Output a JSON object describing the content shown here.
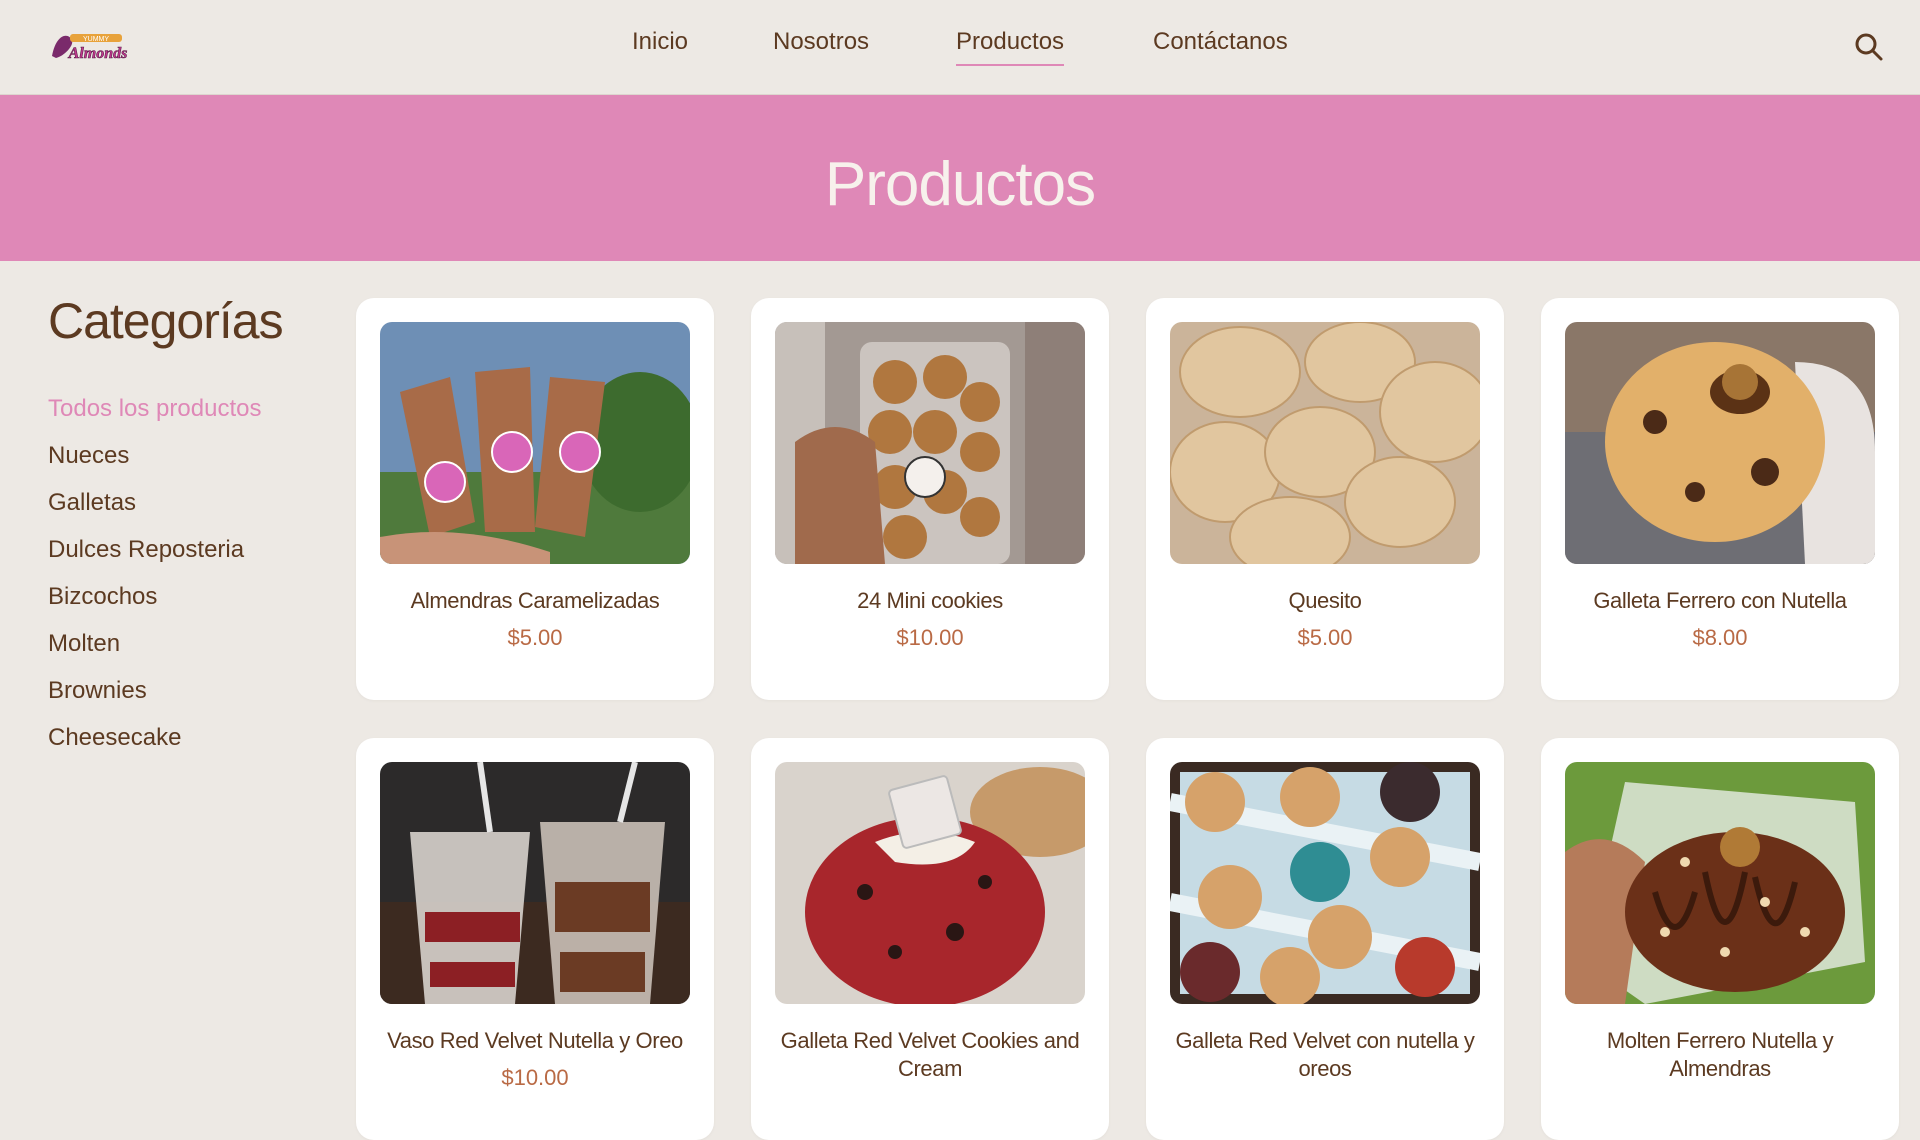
{
  "brand": {
    "logo_text": "Almonds",
    "logo_top_text": "YUMMY"
  },
  "nav": {
    "items": [
      {
        "label": "Inicio",
        "active": false
      },
      {
        "label": "Nosotros",
        "active": false
      },
      {
        "label": "Productos",
        "active": true
      },
      {
        "label": "Contáctanos",
        "active": false
      }
    ],
    "search_icon": "search-icon"
  },
  "banner": {
    "title": "Productos"
  },
  "sidebar": {
    "title": "Categorías",
    "categories": [
      {
        "label": "Todos los productos",
        "active": true
      },
      {
        "label": "Nueces",
        "active": false
      },
      {
        "label": "Galletas",
        "active": false
      },
      {
        "label": "Dulces Reposteria",
        "active": false
      },
      {
        "label": "Bizcochos",
        "active": false
      },
      {
        "label": "Molten",
        "active": false
      },
      {
        "label": "Brownies",
        "active": false
      },
      {
        "label": "Cheesecake",
        "active": false
      }
    ]
  },
  "products": [
    {
      "name": "Almendras Caramelizadas",
      "price": "$5.00"
    },
    {
      "name": "24 Mini cookies",
      "price": "$10.00"
    },
    {
      "name": "Quesito",
      "price": "$5.00"
    },
    {
      "name": "Galleta Ferrero con Nutella",
      "price": "$8.00"
    },
    {
      "name": "Vaso Red Velvet Nutella y Oreo",
      "price": "$10.00"
    },
    {
      "name": "Galleta Red Velvet Cookies and Cream",
      "price": ""
    },
    {
      "name": "Galleta Red Velvet con nutella y oreos",
      "price": ""
    },
    {
      "name": "Molten Ferrero Nutella y Almendras",
      "price": ""
    }
  ],
  "colors": {
    "background": "#ede9e4",
    "accent_pink": "#df88b7",
    "text_brown": "#5c3a21",
    "price": "#b96a45",
    "banner_text": "#f7f1ec"
  }
}
